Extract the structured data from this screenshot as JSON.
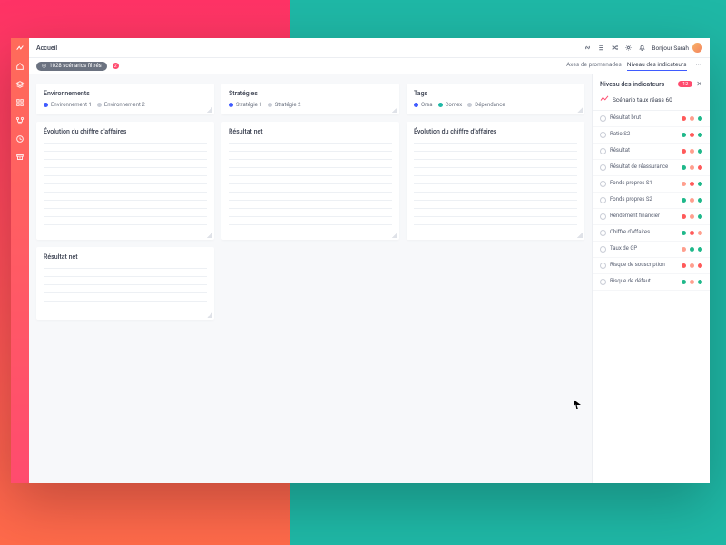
{
  "topbar": {
    "title": "Accueil",
    "user_label": "Bonjour Sarah"
  },
  "filter": {
    "pill_label": "1028 scénarios filtrés",
    "badge_count": "2",
    "tabs": {
      "axes": "Axes de promenades",
      "indicators": "Niveau des indicateurs"
    }
  },
  "cards": {
    "environments": {
      "title": "Environnements",
      "items": [
        {
          "label": "Environnement 1",
          "color": "#3f5bff"
        },
        {
          "label": "Environnement 2",
          "color": "#c9cdd6"
        }
      ]
    },
    "strategies": {
      "title": "Stratégies",
      "items": [
        {
          "label": "Stratégie 1",
          "color": "#3f5bff"
        },
        {
          "label": "Stratégie 2",
          "color": "#c9cdd6"
        }
      ]
    },
    "tags": {
      "title": "Tags",
      "items": [
        {
          "label": "Orsa",
          "color": "#3f5bff"
        },
        {
          "label": "Comex",
          "color": "#1fb8a6"
        },
        {
          "label": "Dépendance",
          "color": "#c9cdd6"
        }
      ]
    },
    "chart1": {
      "title": "Évolution du chiffre d'affaires"
    },
    "chart2": {
      "title": "Résultat net"
    },
    "chart3": {
      "title": "Évolution du chiffre d'affaires"
    },
    "chart4": {
      "title": "Résultat net"
    }
  },
  "indicator_panel": {
    "title": "Niveau des indicateurs",
    "badge": "12",
    "scenario": "Scénario taux réass 60",
    "colors": {
      "bad": "#ff5a5a",
      "mid": "#ff9f8e",
      "good": "#1fb88a"
    },
    "rows": [
      {
        "label": "Résultat brut",
        "dots": [
          "bad",
          "mid",
          "good"
        ]
      },
      {
        "label": "Ratio S2",
        "dots": [
          "good",
          "bad",
          "good"
        ]
      },
      {
        "label": "Résultat",
        "dots": [
          "bad",
          "mid",
          "good"
        ]
      },
      {
        "label": "Résultat de réassurance",
        "dots": [
          "good",
          "mid",
          "bad"
        ]
      },
      {
        "label": "Fonds propres S1",
        "dots": [
          "mid",
          "bad",
          "good"
        ]
      },
      {
        "label": "Fonds propres S2",
        "dots": [
          "good",
          "mid",
          "good"
        ]
      },
      {
        "label": "Rendement financier",
        "dots": [
          "bad",
          "mid",
          "good"
        ]
      },
      {
        "label": "Chiffre d'affaires",
        "dots": [
          "good",
          "bad",
          "mid"
        ]
      },
      {
        "label": "Taux de GP",
        "dots": [
          "mid",
          "good",
          "good"
        ]
      },
      {
        "label": "Risque de souscription",
        "dots": [
          "bad",
          "mid",
          "bad"
        ]
      },
      {
        "label": "Risque de défaut",
        "dots": [
          "good",
          "mid",
          "good"
        ]
      }
    ]
  }
}
